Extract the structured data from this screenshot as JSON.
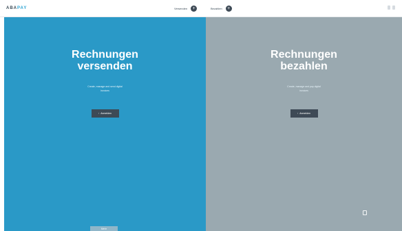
{
  "brand": {
    "name_part1": "ABA",
    "name_part2": "PAY"
  },
  "nav": [
    {
      "label": "Versenden",
      "icon": "plus-icon"
    },
    {
      "label": "Bezahlen",
      "icon": "plus-icon"
    }
  ],
  "left_panel": {
    "headline_line1": "Rechnungen",
    "headline_line2": "versenden",
    "subtext_line1": "Create, manage and send digital",
    "subtext_line2": "invoices",
    "cta_label": "Anmelden",
    "bottom_label": "Mehr",
    "color": "#2a99c7"
  },
  "right_panel": {
    "headline_line1": "Rechnungen",
    "headline_line2": "bezahlen",
    "subtext_line1": "Create, manage and pay digital",
    "subtext_line2": "invoices",
    "cta_label": "Anmelden",
    "color": "#9aa9b0"
  }
}
